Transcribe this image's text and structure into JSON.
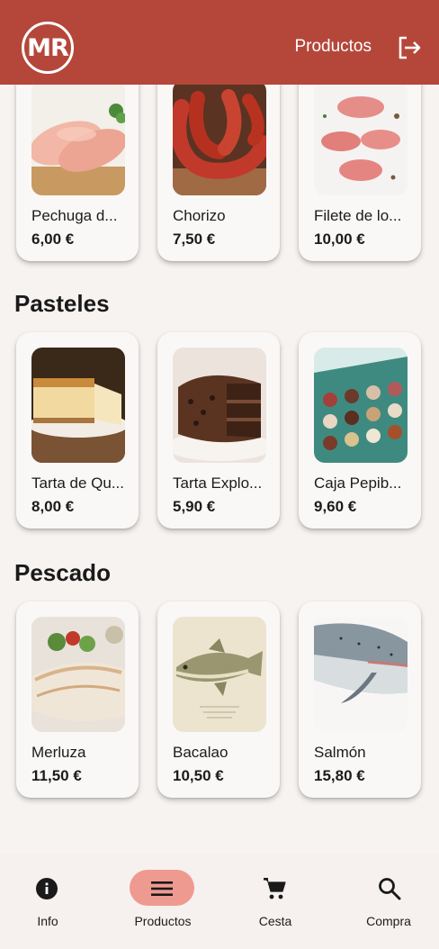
{
  "appbar": {
    "logo_text": "MR",
    "title": "Productos",
    "logout_icon": "logout-icon",
    "color": "#b5473a"
  },
  "sections": [
    {
      "title": "",
      "products": [
        {
          "name": "Pechuga d...",
          "price": "6,00 €",
          "image": "chicken-breast-image"
        },
        {
          "name": "Chorizo",
          "price": "7,50 €",
          "image": "chorizo-image"
        },
        {
          "name": "Filete de lo...",
          "price": "10,00 €",
          "image": "loin-steak-image"
        }
      ]
    },
    {
      "title": "Pasteles",
      "products": [
        {
          "name": "Tarta de Qu...",
          "price": "8,00 €",
          "image": "cheesecake-image"
        },
        {
          "name": "Tarta Explo...",
          "price": "5,90 €",
          "image": "chocolate-cake-image"
        },
        {
          "name": "Caja Pepib...",
          "price": "9,60 €",
          "image": "bonbon-box-image"
        }
      ]
    },
    {
      "title": "Pescado",
      "products": [
        {
          "name": "Merluza",
          "price": "11,50 €",
          "image": "hake-image"
        },
        {
          "name": "Bacalao",
          "price": "10,50 €",
          "image": "cod-image"
        },
        {
          "name": "Salmón",
          "price": "15,80 €",
          "image": "salmon-image"
        }
      ]
    }
  ],
  "bottom_nav": [
    {
      "label": "Info",
      "icon": "info-icon",
      "active": false
    },
    {
      "label": "Productos",
      "icon": "menu-icon",
      "active": true
    },
    {
      "label": "Cesta",
      "icon": "cart-icon",
      "active": false
    },
    {
      "label": "Compra",
      "icon": "search-icon",
      "active": false
    }
  ],
  "colors": {
    "accent": "#b5473a",
    "nav_active": "#ef9a90",
    "background": "#f6f3f1"
  }
}
